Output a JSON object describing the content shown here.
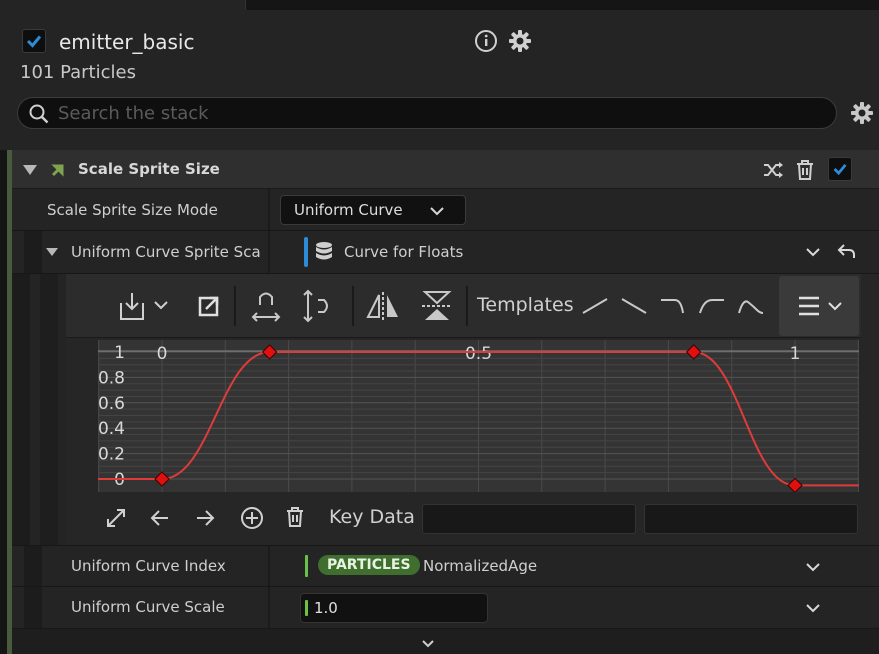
{
  "emitter": {
    "name": "emitter_basic",
    "particles_label": "101 Particles",
    "enabled": true
  },
  "search": {
    "placeholder": "Search the stack",
    "value": ""
  },
  "module": {
    "title": "Scale Sprite Size",
    "enabled": true,
    "mode_label": "Scale Sprite Size Mode",
    "mode_value": "Uniform Curve",
    "curve_label": "Uniform Curve Sprite Scale",
    "curve_value": "Curve for Floats"
  },
  "curve_editor": {
    "templates_label": "Templates",
    "key_data_label": "Key Data",
    "key_data_time": "",
    "key_data_value": "",
    "y_ticks": [
      "1",
      "0.8",
      "0.6",
      "0.4",
      "0.2",
      "0"
    ],
    "x_ticks": [
      "0",
      "0.5",
      "1"
    ],
    "curve_color": "#e03b3b",
    "keys": [
      {
        "time": 0.0,
        "value": 0.0
      },
      {
        "time": 0.17,
        "value": 1.0
      },
      {
        "time": 0.84,
        "value": 1.0
      },
      {
        "time": 1.0,
        "value": -0.05
      }
    ]
  },
  "index_row": {
    "label": "Uniform Curve Index",
    "badge": "PARTICLES",
    "value": "NormalizedAge"
  },
  "scale_row": {
    "label": "Uniform Curve Scale",
    "value": "1.0"
  },
  "colors": {
    "accent_blue": "#2c8cd8",
    "accent_green": "#6ac14a",
    "badge_green": "#3f6e2f"
  }
}
